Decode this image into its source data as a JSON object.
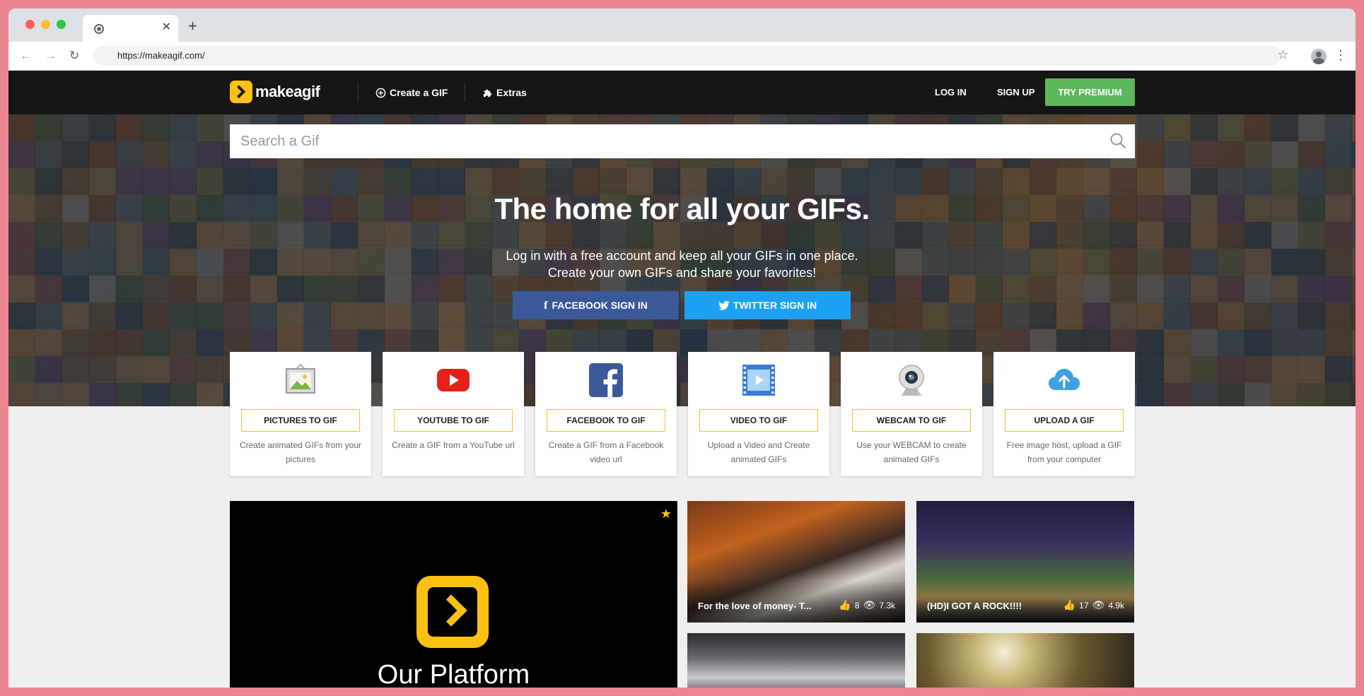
{
  "browser": {
    "url": "https://makeagif.com/",
    "tab_close": "✕",
    "new_tab": "+"
  },
  "header": {
    "logo_text": "makeagif",
    "create_label": "Create a GIF",
    "extras_label": "Extras",
    "login_label": "LOG IN",
    "signup_label": "SIGN UP",
    "premium_label": "TRY PREMIUM",
    "premium_color": "#5cb85c",
    "brand_color": "#fdc112"
  },
  "search": {
    "placeholder": "Search a Gif"
  },
  "hero": {
    "title": "The home for all your GIFs.",
    "subtitle_line1": "Log in with a free account and keep all your GIFs in one place.",
    "subtitle_line2": "Create your own GIFs and share your favorites!",
    "facebook_label": "FACEBOOK SIGN IN",
    "twitter_label": "TWITTER SIGN IN",
    "facebook_color": "#3b5998",
    "twitter_color": "#1da1f2"
  },
  "tools": [
    {
      "icon": "picture-icon",
      "label": "PICTURES TO GIF",
      "desc": "Create animated GIFs from your pictures"
    },
    {
      "icon": "youtube-icon",
      "label": "YOUTUBE TO GIF",
      "desc": "Create a GIF from a YouTube url"
    },
    {
      "icon": "facebook-icon",
      "label": "FACEBOOK TO GIF",
      "desc": "Create a GIF from a Facebook video url"
    },
    {
      "icon": "video-icon",
      "label": "VIDEO TO GIF",
      "desc": "Upload a Video and Create animated GIFs"
    },
    {
      "icon": "webcam-icon",
      "label": "WEBCAM TO GIF",
      "desc": "Use your WEBCAM to create animated GIFs"
    },
    {
      "icon": "cloud-upload-icon",
      "label": "UPLOAD A GIF",
      "desc": "Free image host, upload a GIF from your computer"
    }
  ],
  "featured": {
    "text": "Our Platform"
  },
  "gifs": [
    {
      "title": "For the love of money- T...",
      "likes": "8",
      "views": "7.3k"
    },
    {
      "title": "(HD)I GOT A ROCK!!!!",
      "likes": "17",
      "views": "4.9k"
    }
  ]
}
